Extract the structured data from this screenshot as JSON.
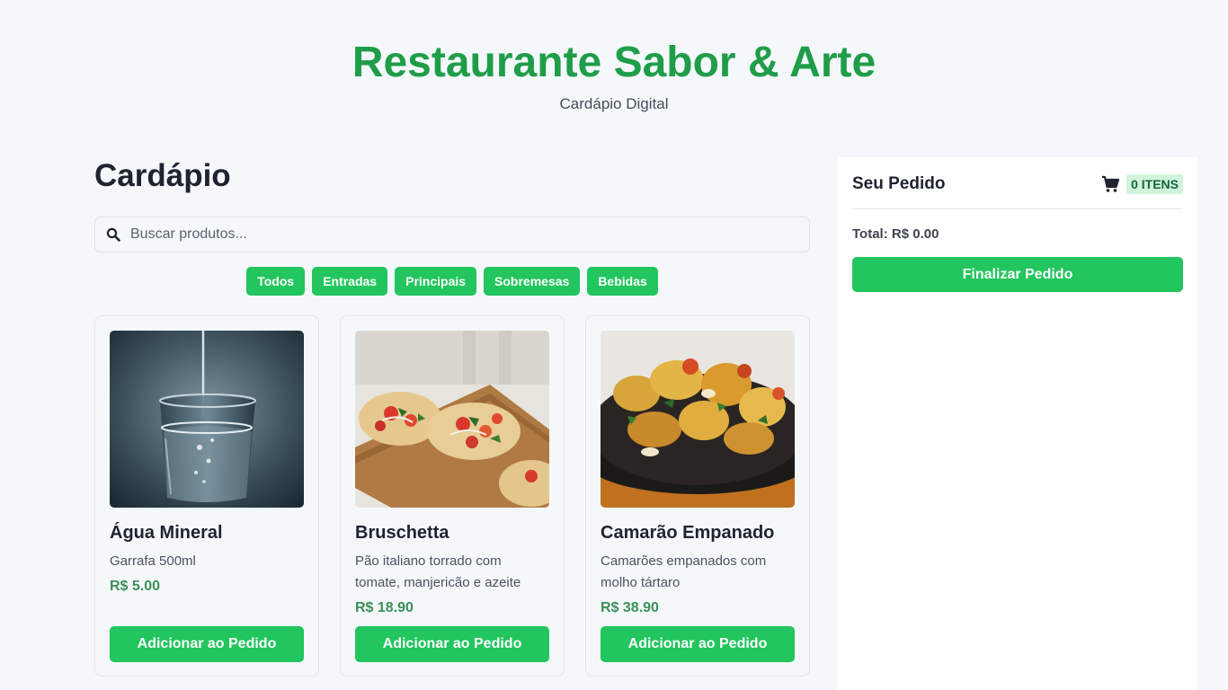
{
  "header": {
    "title": "Restaurante Sabor & Arte",
    "subtitle": "Cardápio Digital"
  },
  "menu": {
    "heading": "Cardápio",
    "search": {
      "placeholder": "Buscar produtos...",
      "value": ""
    },
    "filters": [
      "Todos",
      "Entradas",
      "Principais",
      "Sobremesas",
      "Bebidas"
    ],
    "products": [
      {
        "name": "Água Mineral",
        "description": "Garrafa 500ml",
        "price": "R$ 5.00",
        "button": "Adicionar ao Pedido",
        "image": "glass-of-water"
      },
      {
        "name": "Bruschetta",
        "description": "Pão italiano torrado com tomate, manjericão e azeite",
        "price": "R$ 18.90",
        "button": "Adicionar ao Pedido",
        "image": "bruschetta-on-board"
      },
      {
        "name": "Camarão Empanado",
        "description": "Camarões empanados com molho tártaro",
        "price": "R$ 38.90",
        "button": "Adicionar ao Pedido",
        "image": "grilled-dish-in-pan"
      }
    ]
  },
  "order": {
    "title": "Seu Pedido",
    "items_badge": "0 ITENS",
    "total": "Total: R$ 0.00",
    "finalize_label": "Finalizar Pedido"
  },
  "icons": {
    "search": "search-icon",
    "cart": "cart-icon"
  },
  "colors": {
    "brand": "#1f9d48",
    "accent": "#22c55e",
    "price": "#3c8f5a"
  }
}
